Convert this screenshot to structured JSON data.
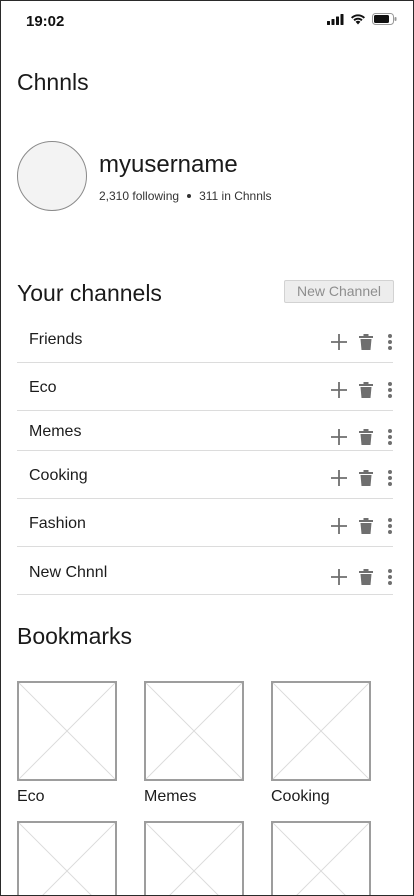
{
  "status_bar": {
    "time": "19:02"
  },
  "app": {
    "title": "Chnnls"
  },
  "profile": {
    "username": "myusername",
    "following": "2,310 following",
    "in_chnnls": "311 in Chnnls"
  },
  "channels": {
    "section_title": "Your channels",
    "new_channel_label": "New Channel",
    "items": [
      {
        "label": "Friends"
      },
      {
        "label": "Eco"
      },
      {
        "label": "Memes"
      },
      {
        "label": "Cooking"
      },
      {
        "label": "Fashion"
      },
      {
        "label": "New Chnnl"
      }
    ]
  },
  "bookmarks": {
    "section_title": "Bookmarks",
    "items": [
      {
        "label": "Eco"
      },
      {
        "label": "Memes"
      },
      {
        "label": "Cooking"
      },
      {
        "label": ""
      },
      {
        "label": ""
      },
      {
        "label": ""
      }
    ]
  },
  "icons": {
    "add": "plus-icon",
    "delete": "trash-icon",
    "more": "more-vertical-icon",
    "placeholder": "image-placeholder-icon"
  },
  "colors": {
    "text": "#1c1c1c",
    "icon_gray": "#6f6f6f",
    "divider": "#dcdcdc",
    "button_bg": "#ededed",
    "button_text": "#8e8e8e"
  }
}
